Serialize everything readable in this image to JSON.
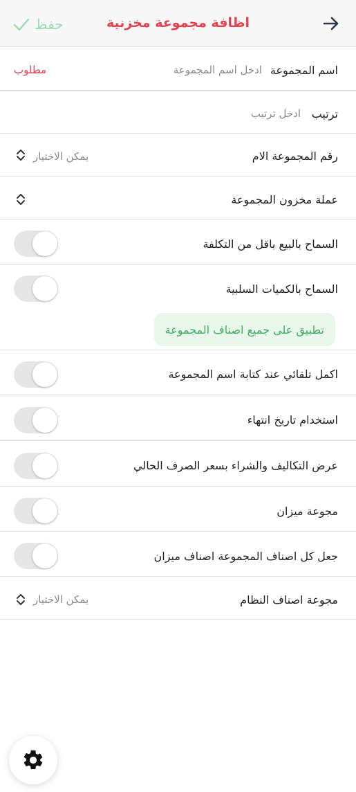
{
  "header": {
    "title": "اظافة مجموعة مخزنية",
    "save_label": "حفظ",
    "back_icon": "arrow-right-icon",
    "save_icon": "check-icon",
    "title_color": "#e0424f",
    "save_color": "#9bdcb1"
  },
  "form": {
    "group_name": {
      "label": "اسم المجموعة",
      "placeholder": "ادخل اسم المجموعة",
      "required": "مطلوب"
    },
    "order": {
      "label": "ترتيب",
      "placeholder": "ادخل ترتيب"
    },
    "parent_group": {
      "label": "رقم المجموعة الام",
      "value": "يمكن الاختيار"
    },
    "currency": {
      "label": "عملة مخزون المجموعة"
    },
    "toggles": [
      {
        "label": "السماح بالبيع باقل من التكلفة",
        "on": false
      },
      {
        "label": "السماح بالكميات السلبية",
        "on": false
      },
      {
        "label": "اكمل تلقائي عند كتابة اسم المجموعة",
        "on": false
      },
      {
        "label": "استخدام تاريخ انتهاء",
        "on": false
      },
      {
        "label": "عرض التكاليف والشراء بسعر الصرف الحالي",
        "on": false
      },
      {
        "label": "مجوعة ميزان",
        "on": false
      },
      {
        "label": "جعل كل اصناف المجموعة اصناف ميزان",
        "on": false
      }
    ],
    "apply_all_button": "تطبيق على جميع اصناف المجموعة",
    "system_items_group": {
      "label": "مجوعة اصناف النظام",
      "value": "يمكن الاختيار"
    }
  },
  "fab_icon": "gear-icon",
  "colors": {
    "accent_red": "#e0424f",
    "accent_green": "#3fae62",
    "toggle_off": "#e6e6e6"
  }
}
